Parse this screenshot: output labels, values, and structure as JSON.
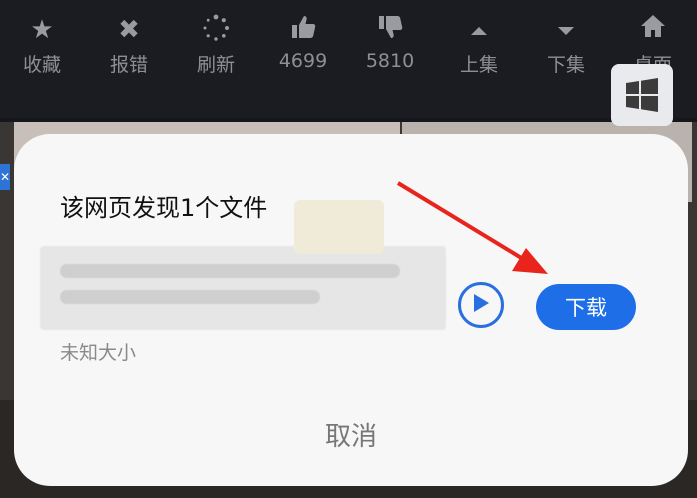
{
  "toolbar": {
    "items": [
      {
        "label": "收藏",
        "icon": "star-icon"
      },
      {
        "label": "报错",
        "icon": "close-icon"
      },
      {
        "label": "刷新",
        "icon": "refresh-icon"
      },
      {
        "label": "4699",
        "icon": "thumbs-up-icon"
      },
      {
        "label": "5810",
        "icon": "thumbs-down-icon"
      },
      {
        "label": "上集",
        "icon": "chevron-up-icon"
      },
      {
        "label": "下集",
        "icon": "chevron-down-icon"
      },
      {
        "label": "桌面",
        "icon": "home-icon"
      }
    ]
  },
  "dialog": {
    "title": "该网页发现1个文件",
    "file_size": "未知大小",
    "download_label": "下载",
    "cancel_label": "取消"
  },
  "colors": {
    "accent": "#1e6ee8",
    "arrow": "#e8241c",
    "dialog_bg": "#f7f7f7",
    "toolbar_bg": "#1b1c22"
  }
}
